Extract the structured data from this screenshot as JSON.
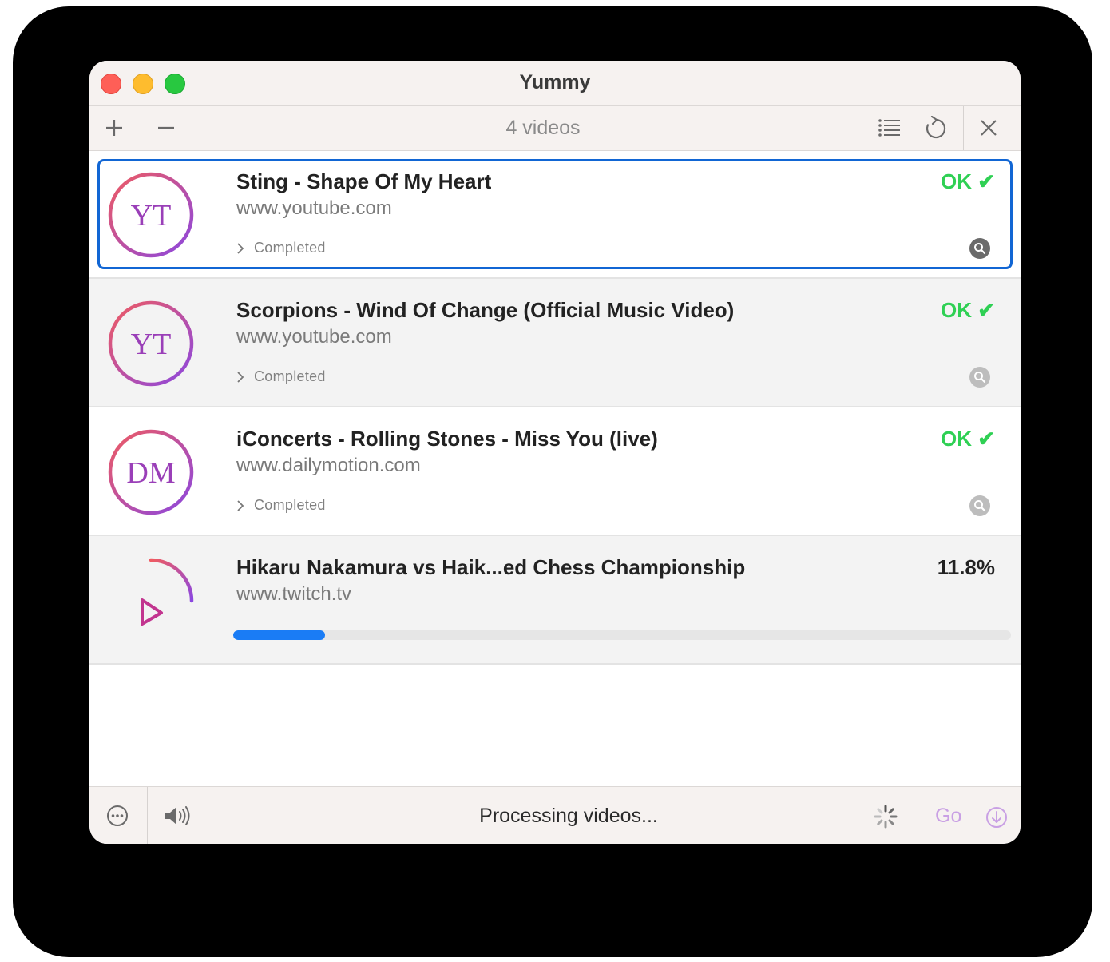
{
  "window": {
    "title": "Yummy"
  },
  "toolbar": {
    "count_label": "4 videos",
    "add_icon": "plus-icon",
    "remove_icon": "minus-icon",
    "list_icon": "list-icon",
    "refresh_icon": "refresh-icon",
    "close_icon": "close-icon"
  },
  "videos": [
    {
      "title": "Sting - Shape Of My Heart",
      "site": "www.youtube.com",
      "badge": "YT",
      "status": "Completed",
      "result": "OK ✔",
      "selected": true
    },
    {
      "title": "Scorpions - Wind Of Change (Official Music Video)",
      "site": "www.youtube.com",
      "badge": "YT",
      "status": "Completed",
      "result": "OK ✔"
    },
    {
      "title": "iConcerts - Rolling Stones - Miss You (live)",
      "site": "www.dailymotion.com",
      "badge": "DM",
      "status": "Completed",
      "result": "OK ✔"
    },
    {
      "title": "Hikaru Nakamura vs Haik...ed Chess Championship",
      "site": "www.twitch.tv",
      "progress_label": "11.8%",
      "progress": 0.118
    }
  ],
  "bottom": {
    "status": "Processing videos...",
    "go_label": "Go",
    "more_icon": "ellipsis-circle-icon",
    "sound_icon": "speaker-icon",
    "spinner_icon": "spinner-icon",
    "download_icon": "download-circle-icon"
  },
  "colors": {
    "ok": "#2fd054",
    "accent": "#1a7cf5",
    "selection": "#1166d4",
    "go": "#c9a0e4"
  }
}
